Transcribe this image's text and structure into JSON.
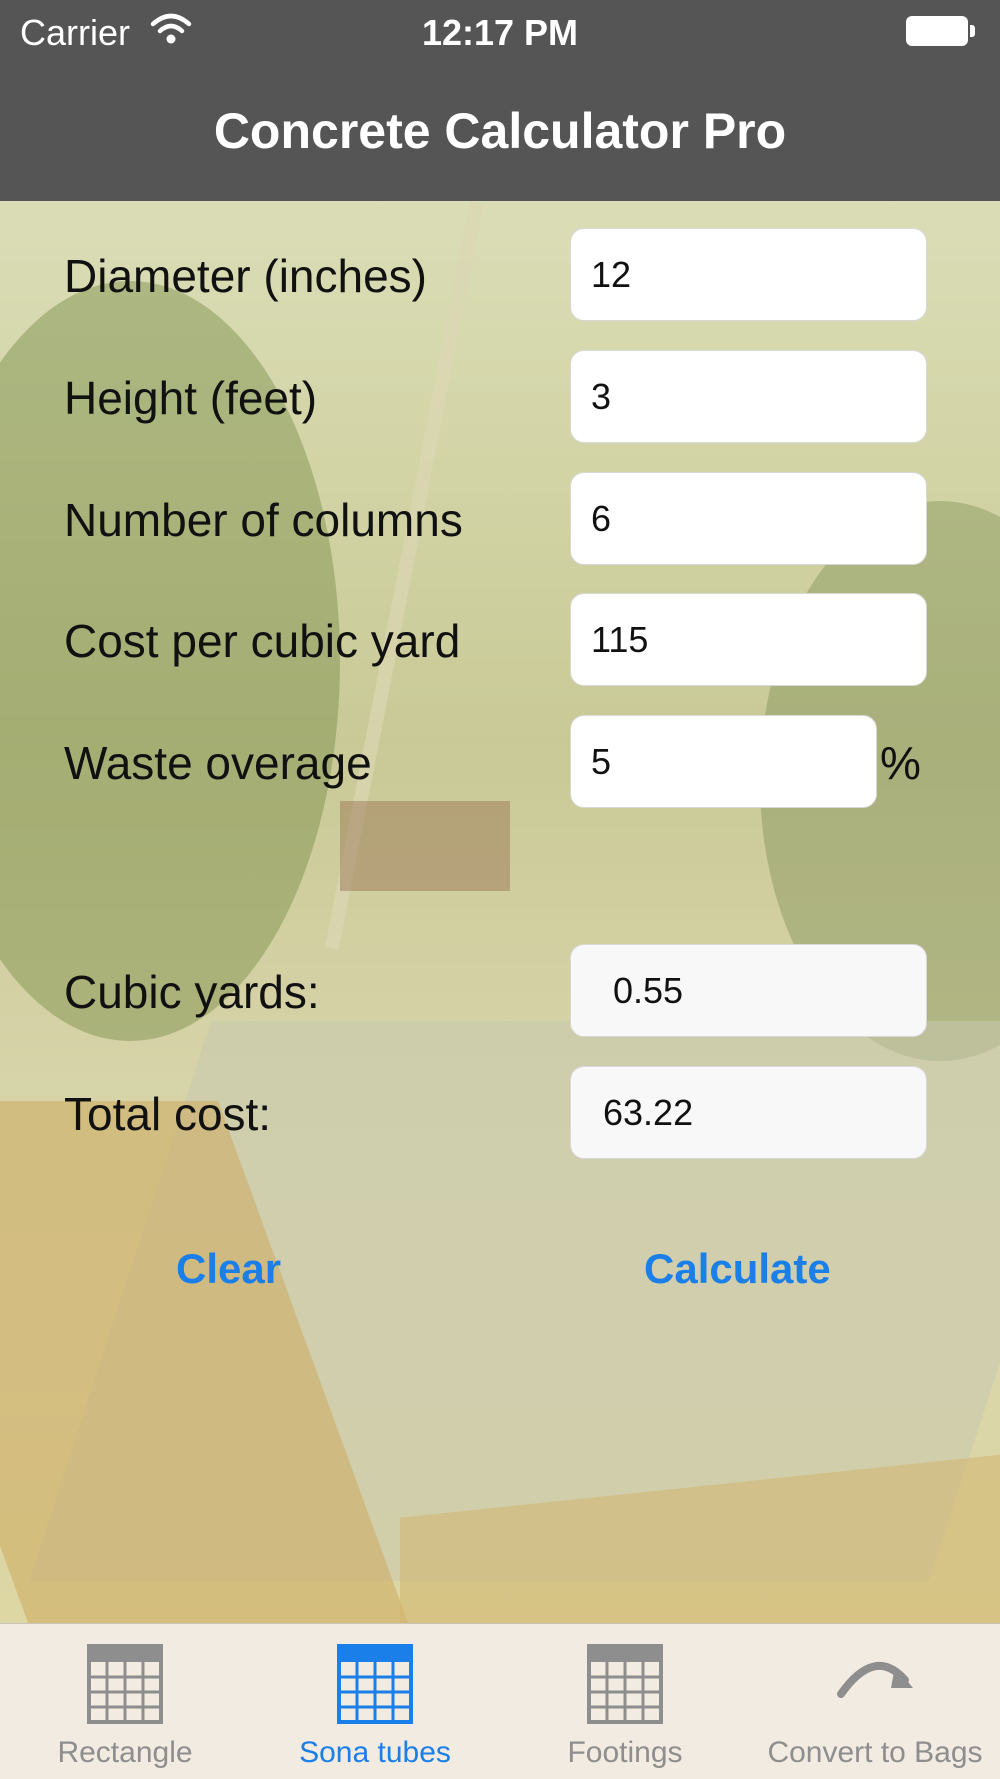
{
  "status_bar": {
    "carrier": "Carrier",
    "time": "12:17 PM",
    "battery_icon": "battery-full-icon",
    "wifi_icon": "wifi-icon"
  },
  "nav": {
    "title": "Concrete Calculator Pro"
  },
  "form": {
    "rows": [
      {
        "label": "Diameter (inches)",
        "value": "12"
      },
      {
        "label": "Height (feet)",
        "value": "3"
      },
      {
        "label": "Number of columns",
        "value": "6"
      },
      {
        "label": "Cost per cubic yard",
        "value": "115"
      },
      {
        "label": "Waste overage",
        "value": "5",
        "suffix": "%"
      }
    ]
  },
  "results": {
    "cubic_yards_label": "Cubic yards:",
    "cubic_yards_value": "0.55",
    "total_cost_label": "Total cost:",
    "total_cost_value": "63.22"
  },
  "actions": {
    "clear": "Clear",
    "calculate": "Calculate"
  },
  "tabs": [
    {
      "label": "Rectangle",
      "icon": "calculator-grid-icon",
      "active": false
    },
    {
      "label": "Sona tubes",
      "icon": "calculator-grid-icon",
      "active": true
    },
    {
      "label": "Footings",
      "icon": "calculator-grid-icon",
      "active": false
    },
    {
      "label": "Convert to Bags",
      "icon": "redo-arrow-icon",
      "active": false
    }
  ],
  "colors": {
    "nav_bg": "#555555",
    "accent": "#1a7fe8",
    "tab_inactive": "#8e8e8e",
    "tabbar_bg": "#f1ebe1"
  }
}
